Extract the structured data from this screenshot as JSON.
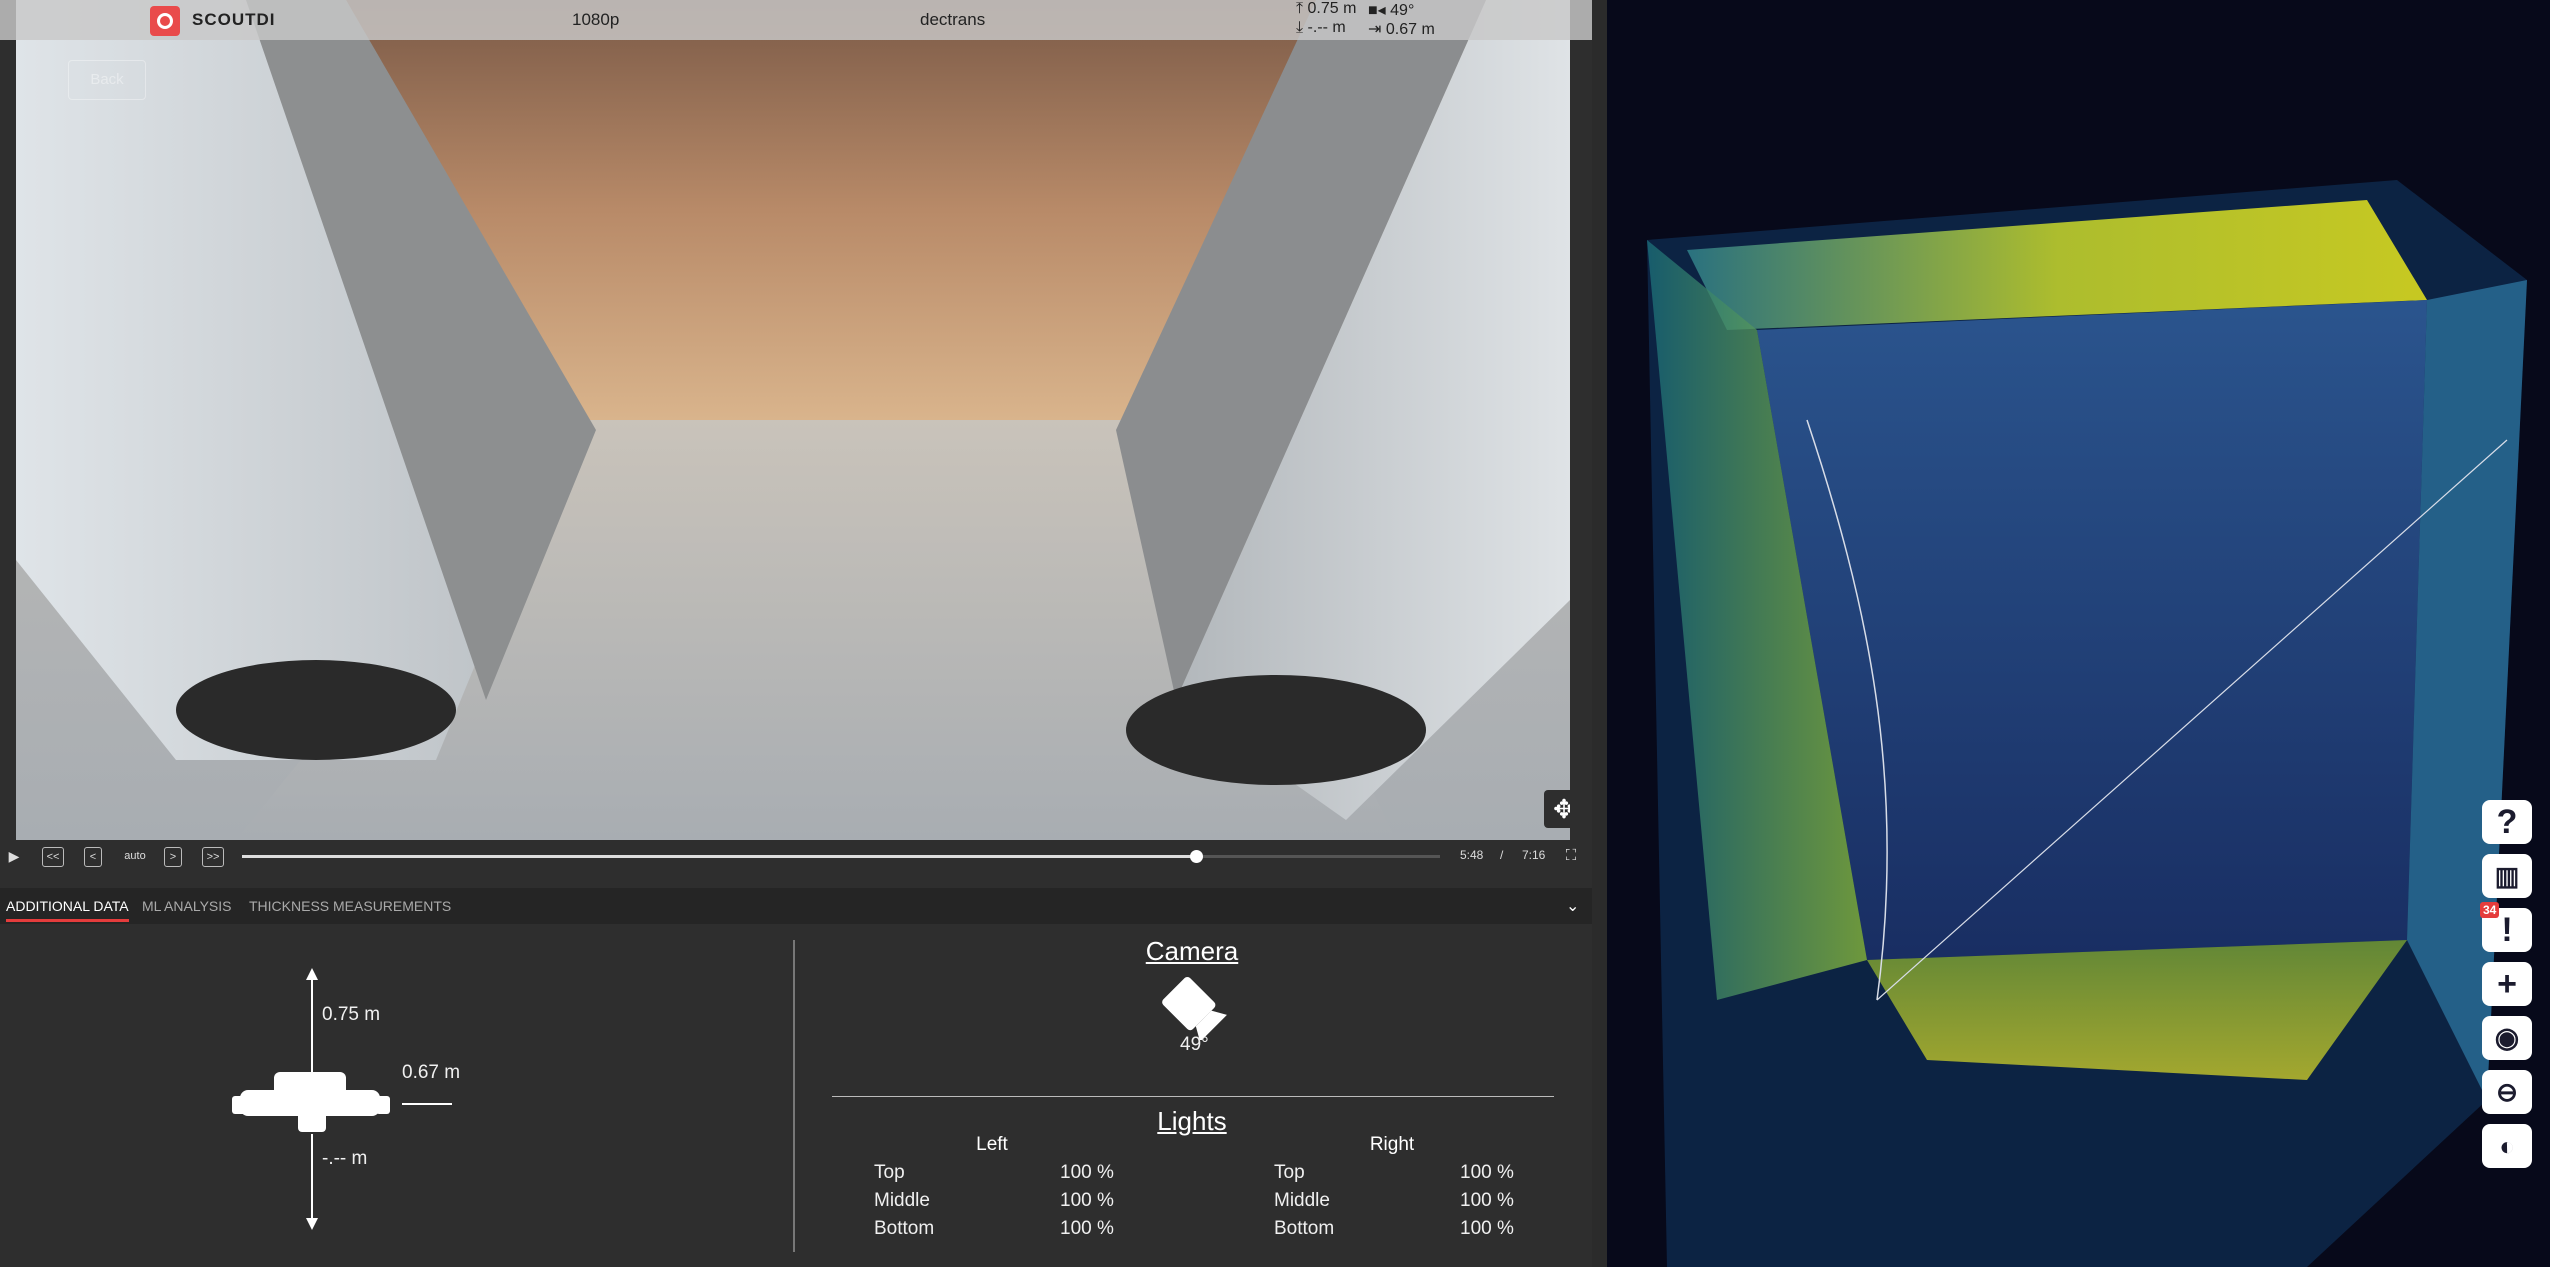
{
  "header": {
    "logo_text": "SCOUTDI",
    "resolution": "1080p",
    "user": "dectrans",
    "status": {
      "up_distance": "0.75 m",
      "camera_angle": "49°",
      "down_distance": "-.-- m",
      "forward_distance": "0.67 m"
    }
  },
  "video": {
    "back_label": "Back"
  },
  "controls": {
    "speed_label": "auto",
    "rewind_label": "<<",
    "step_back_label": "<",
    "step_forward_label": ">",
    "fast_forward_label": ">>",
    "current_time": "5:48",
    "separator": "/",
    "total_time": "7:16",
    "progress_fraction": 0.796
  },
  "tabs": [
    {
      "label": "ADDITIONAL DATA",
      "active": true
    },
    {
      "label": "ML ANALYSIS",
      "active": false
    },
    {
      "label": "THICKNESS MEASUREMENTS",
      "active": false
    }
  ],
  "additional_data": {
    "distance_up": "0.75 m",
    "distance_forward": "0.67 m",
    "distance_down": "-.-- m",
    "camera": {
      "title": "Camera",
      "angle": "49°"
    },
    "lights": {
      "title": "Lights",
      "left_label": "Left",
      "right_label": "Right",
      "left": [
        {
          "name": "Top",
          "value": "100 %"
        },
        {
          "name": "Middle",
          "value": "100 %"
        },
        {
          "name": "Bottom",
          "value": "100 %"
        }
      ],
      "right": [
        {
          "name": "Top",
          "value": "100 %"
        },
        {
          "name": "Middle",
          "value": "100 %"
        },
        {
          "name": "Bottom",
          "value": "100 %"
        }
      ]
    }
  },
  "sidebar": {
    "help_icon": "?",
    "map_icon": "map-icon",
    "alerts_icon": "!",
    "alerts_badge": "34",
    "add_icon": "+",
    "eye_icon": "eye-icon",
    "measure_icon": "measure-icon",
    "toggle_icon": "toggle-icon"
  },
  "colors": {
    "accent": "#e53c3c",
    "panel_bg": "#2e2e2e",
    "pointcloud_yellow": "#e6e619",
    "pointcloud_teal": "#1f8f8a",
    "pointcloud_blue": "#2b4f8f"
  }
}
